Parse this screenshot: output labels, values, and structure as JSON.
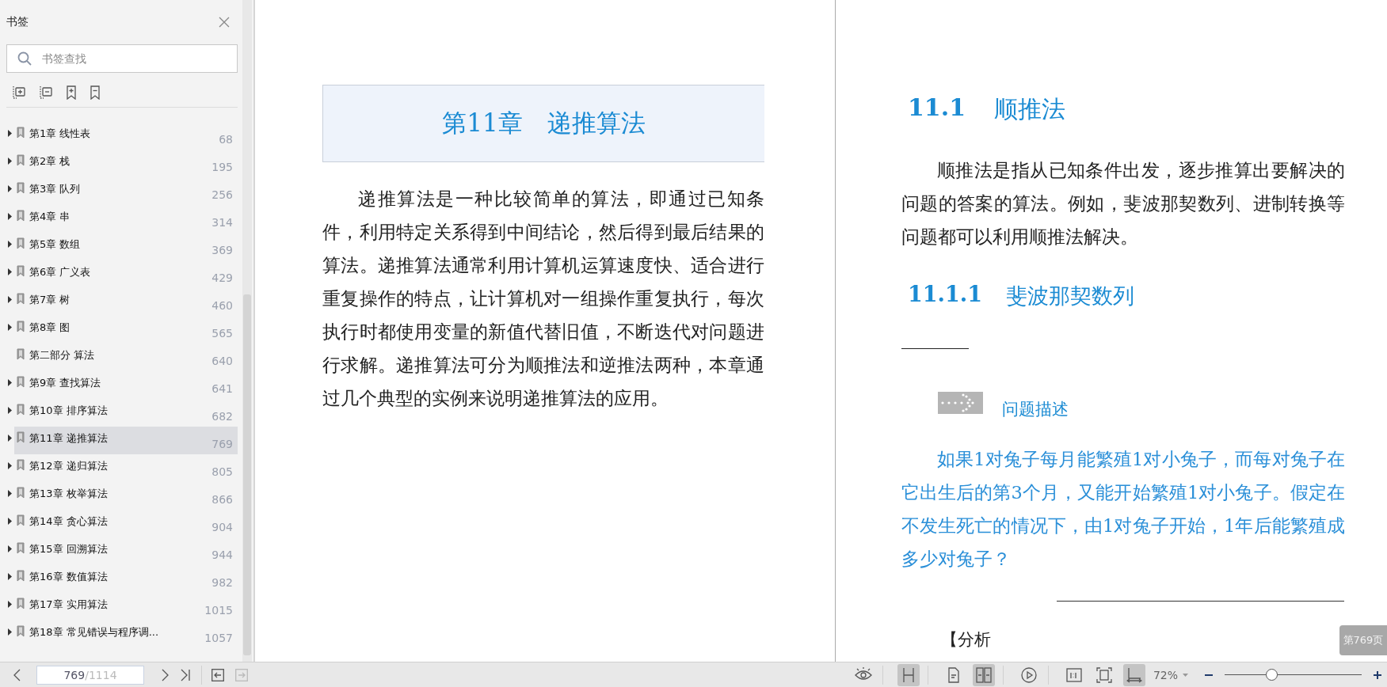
{
  "sidebar": {
    "title": "书签",
    "search": {
      "placeholder": "书签查找"
    },
    "bookmarks": [
      {
        "label": "第1章 线性表",
        "page": "68",
        "has_children": true,
        "selected": false
      },
      {
        "label": "第2章 栈",
        "page": "195",
        "has_children": true,
        "selected": false
      },
      {
        "label": "第3章 队列",
        "page": "256",
        "has_children": true,
        "selected": false
      },
      {
        "label": "第4章 串",
        "page": "314",
        "has_children": true,
        "selected": false
      },
      {
        "label": "第5章 数组",
        "page": "369",
        "has_children": true,
        "selected": false
      },
      {
        "label": "第6章 广义表",
        "page": "429",
        "has_children": true,
        "selected": false
      },
      {
        "label": "第7章 树",
        "page": "460",
        "has_children": true,
        "selected": false
      },
      {
        "label": "第8章 图",
        "page": "565",
        "has_children": true,
        "selected": false
      },
      {
        "label": "第二部分 算法",
        "page": "640",
        "has_children": false,
        "selected": false
      },
      {
        "label": "第9章 查找算法",
        "page": "641",
        "has_children": true,
        "selected": false
      },
      {
        "label": "第10章 排序算法",
        "page": "682",
        "has_children": true,
        "selected": false
      },
      {
        "label": "第11章 递推算法",
        "page": "769",
        "has_children": true,
        "selected": true
      },
      {
        "label": "第12章 递归算法",
        "page": "805",
        "has_children": true,
        "selected": false
      },
      {
        "label": "第13章 枚举算法",
        "page": "866",
        "has_children": true,
        "selected": false
      },
      {
        "label": "第14章 贪心算法",
        "page": "904",
        "has_children": true,
        "selected": false
      },
      {
        "label": "第15章 回溯算法",
        "page": "944",
        "has_children": true,
        "selected": false
      },
      {
        "label": "第16章 数值算法",
        "page": "982",
        "has_children": true,
        "selected": false
      },
      {
        "label": "第17章 实用算法",
        "page": "1015",
        "has_children": true,
        "selected": false
      },
      {
        "label": "第18章 常见错误与程序调...",
        "page": "1057",
        "has_children": true,
        "selected": false
      }
    ]
  },
  "left_page": {
    "chapter_title": "第11章　递推算法",
    "paragraph": "递推算法是一种比较简单的算法，即通过已知条件，利用特定关系得到中间结论，然后得到最后结果的算法。递推算法通常利用计算机运算速度快、适合进行重复操作的特点，让计算机对一组操作重复执行，每次执行时都使用变量的新值代替旧值，不断迭代对问题进行求解。递推算法可分为顺推法和逆推法两种，本章通过几个典型的实例来说明递推算法的应用。"
  },
  "right_page": {
    "section_number": "11.1",
    "section_title": "顺推法",
    "paragraph": "顺推法是指从已知条件出发，逐步推算出要解决的问题的答案的算法。例如，斐波那契数列、进制转换等问题都可以利用顺推法解决。",
    "subsection_number": "11.1.1",
    "subsection_title": "斐波那契数列",
    "problem_heading": "问题描述",
    "problem_text": "如果1对兔子每月能繁殖1对小兔子，而每对兔子在它出生后的第3个月，又能开始繁殖1对小兔子。假定在不发生死亡的情况下，由1对兔子开始，1年后能繁殖成多少对兔子？",
    "analysis_heading": "【分析",
    "page_badge": "第769页"
  },
  "bottom_bar": {
    "page_current": "769",
    "page_total": "/1114",
    "view_buttons": [
      {
        "kind": "eye",
        "selected": false
      },
      {
        "kind": "continuous",
        "selected": true
      },
      {
        "kind": "single",
        "selected": false
      },
      {
        "kind": "double",
        "selected": true
      },
      {
        "kind": "play",
        "selected": false
      },
      {
        "kind": "actual",
        "selected": false
      },
      {
        "kind": "fitpage",
        "selected": false
      },
      {
        "kind": "fitwidth",
        "selected": true
      }
    ],
    "zoom": {
      "label": "72%",
      "level": 0.34
    }
  }
}
